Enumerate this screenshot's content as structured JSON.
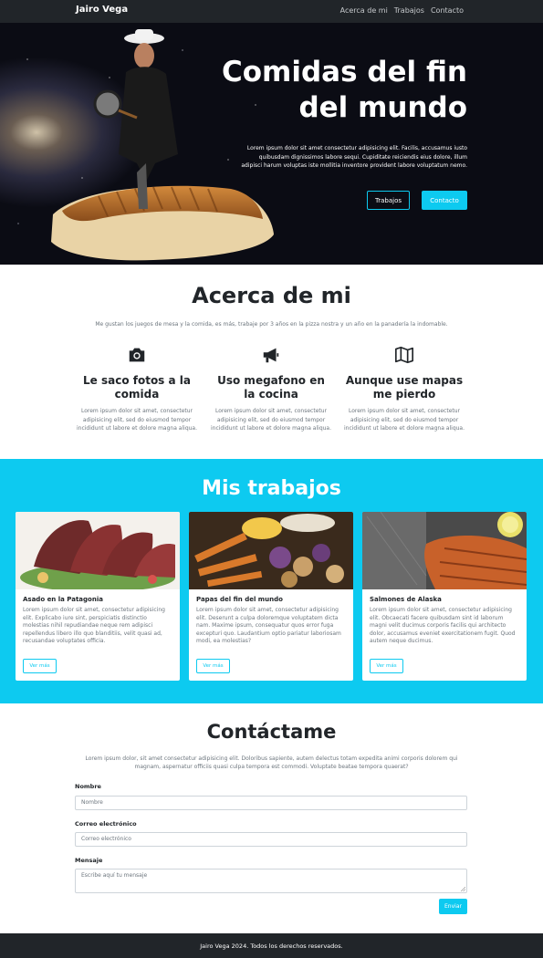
{
  "navbar": {
    "brand": "Jairo Vega",
    "links": [
      "Acerca de mi",
      "Trabajos",
      "Contacto"
    ]
  },
  "hero": {
    "title_line1": "Comidas del fin",
    "title_line2": "del mundo",
    "text": "Lorem ipsum dolor sit amet consectetur adipisicing elit. Facilis, accusamus iusto quibusdam dignissimos labore sequi. Cupiditate reiciendis eius dolore, illum adipisci harum voluptas iste mollitia inventore provident labore voluptatum nemo.",
    "btn_works": "Trabajos",
    "btn_contact": "Contacto"
  },
  "about": {
    "title": "Acerca de mi",
    "lead": "Me gustan los juegos de mesa y la comida, es más, trabaje por 3 años en la pizza nostra y un año en la panadería la indomable.",
    "features": [
      {
        "icon": "camera-icon",
        "title": "Le saco fotos a la comida",
        "text": "Lorem ipsum dolor sit amet, consectetur adipisicing elit, sed do eiusmod tempor incididunt ut labore et dolore magna aliqua."
      },
      {
        "icon": "megaphone-icon",
        "title": "Uso megafono en la cocina",
        "text": "Lorem ipsum dolor sit amet, consectetur adipisicing elit, sed do eiusmod tempor incididunt ut labore et dolore magna aliqua."
      },
      {
        "icon": "map-icon",
        "title": "Aunque use mapas me pierdo",
        "text": "Lorem ipsum dolor sit amet, consectetur adipisicing elit, sed do eiusmod tempor incididunt ut labore et dolore magna aliqua."
      }
    ]
  },
  "works": {
    "title": "Mis trabajos",
    "cards": [
      {
        "title": "Asado en la Patagonia",
        "text": "Lorem ipsum dolor sit amet, consectetur adipisicing elit. Explicabo iure sint, perspiciatis distinctio molestias nihil repudiandae neque rem adipisci repellendus libero illo quo blanditiis, velit quasi ad, recusandae voluptates officia.",
        "button": "Ver más"
      },
      {
        "title": "Papas del fin del mundo",
        "text": "Lorem ipsum dolor sit amet, consectetur adipisicing elit. Deserunt a culpa doloremque voluptatem dicta nam. Maxime ipsum, consequatur quos error fuga excepturi quo. Laudantium optio pariatur laboriosam modi, ea molestias?",
        "button": "Ver más"
      },
      {
        "title": "Salmones de Alaska",
        "text": "Lorem ipsum dolor sit amet, consectetur adipisicing elit. Obcaecati facere quibusdam sint id laborum magni velit ducimus corporis facilis qui architecto dolor, accusamus eveniet exercitationem fugit. Quod autem neque ducimus.",
        "button": "Ver más"
      }
    ]
  },
  "contact": {
    "title": "Contáctame",
    "lead": "Lorem ipsum dolor, sit amet consectetur adipisicing elit. Doloribus sapiente, autem delectus totam expedita animi corporis dolorem qui magnam, aspernatur officiis quasi culpa tempora est commodi. Voluptate beatae tempora quaerat?",
    "name_label": "Nombre",
    "name_placeholder": "Nombre",
    "email_label": "Correo electrónico",
    "email_placeholder": "Correo electrónico",
    "message_label": "Mensaje",
    "message_placeholder": "Escribe aquí tu mensaje",
    "send": "Enviar"
  },
  "footer": {
    "text": "Jairo Vega 2024. Todos los derechos reservados."
  },
  "colors": {
    "accent": "#0dcaf0",
    "dark": "#212529"
  }
}
